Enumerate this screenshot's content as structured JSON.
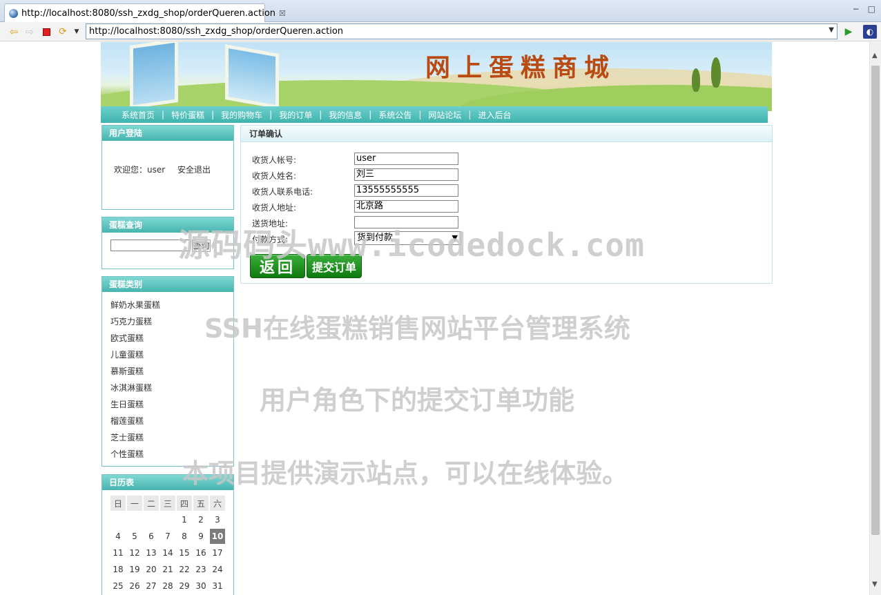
{
  "browser": {
    "tab_title": "http://localhost:8080/ssh_zxdg_shop/orderQueren.action",
    "tab_close": "☒",
    "url": "http://localhost:8080/ssh_zxdg_shop/orderQueren.action",
    "minimize": "−",
    "maximize": "□"
  },
  "site": {
    "title": "网上蛋糕商城"
  },
  "nav": {
    "items": [
      "系统首页",
      "特价蛋糕",
      "我的购物车",
      "我的订单",
      "我的信息",
      "系统公告",
      "网站论坛",
      "进入后台"
    ],
    "separator": "|"
  },
  "login_panel": {
    "title": "用户登陆",
    "welcome": "欢迎您：user",
    "logout": "安全退出"
  },
  "search_panel": {
    "title": "蛋糕查询",
    "input_value": "",
    "button": "查询"
  },
  "category_panel": {
    "title": "蛋糕类别",
    "items": [
      "鲜奶水果蛋糕",
      "巧克力蛋糕",
      "欧式蛋糕",
      "儿童蛋糕",
      "慕斯蛋糕",
      "冰淇淋蛋糕",
      "生日蛋糕",
      "榴莲蛋糕",
      "芝士蛋糕",
      "个性蛋糕"
    ]
  },
  "calendar_panel": {
    "title": "日历表",
    "weekdays": [
      "日",
      "一",
      "二",
      "三",
      "四",
      "五",
      "六"
    ],
    "weeks": [
      [
        "",
        "",
        "",
        "",
        "1",
        "2",
        "3"
      ],
      [
        "4",
        "5",
        "6",
        "7",
        "8",
        "9",
        "10"
      ],
      [
        "11",
        "12",
        "13",
        "14",
        "15",
        "16",
        "17"
      ],
      [
        "18",
        "19",
        "20",
        "21",
        "22",
        "23",
        "24"
      ],
      [
        "25",
        "26",
        "27",
        "28",
        "29",
        "30",
        "31"
      ]
    ],
    "today": "10"
  },
  "order_panel": {
    "title": "订单确认",
    "fields": [
      {
        "label": "收货人帐号:",
        "value": "user"
      },
      {
        "label": "收货人姓名:",
        "value": "刘三"
      },
      {
        "label": "收货人联系电话:",
        "value": "13555555555"
      },
      {
        "label": "收货人地址:",
        "value": "北京路"
      },
      {
        "label": "送货地址:",
        "value": ""
      }
    ],
    "payment_label": "付款方式:",
    "payment_value": "货到付款",
    "back_button": "返回",
    "submit_button": "提交订单"
  },
  "watermarks": [
    "源码码头www.icodedock.com",
    "SSH在线蛋糕销售网站平台管理系统",
    "用户角色下的提交订单功能",
    "本项目提供演示站点，可以在线体验。"
  ]
}
